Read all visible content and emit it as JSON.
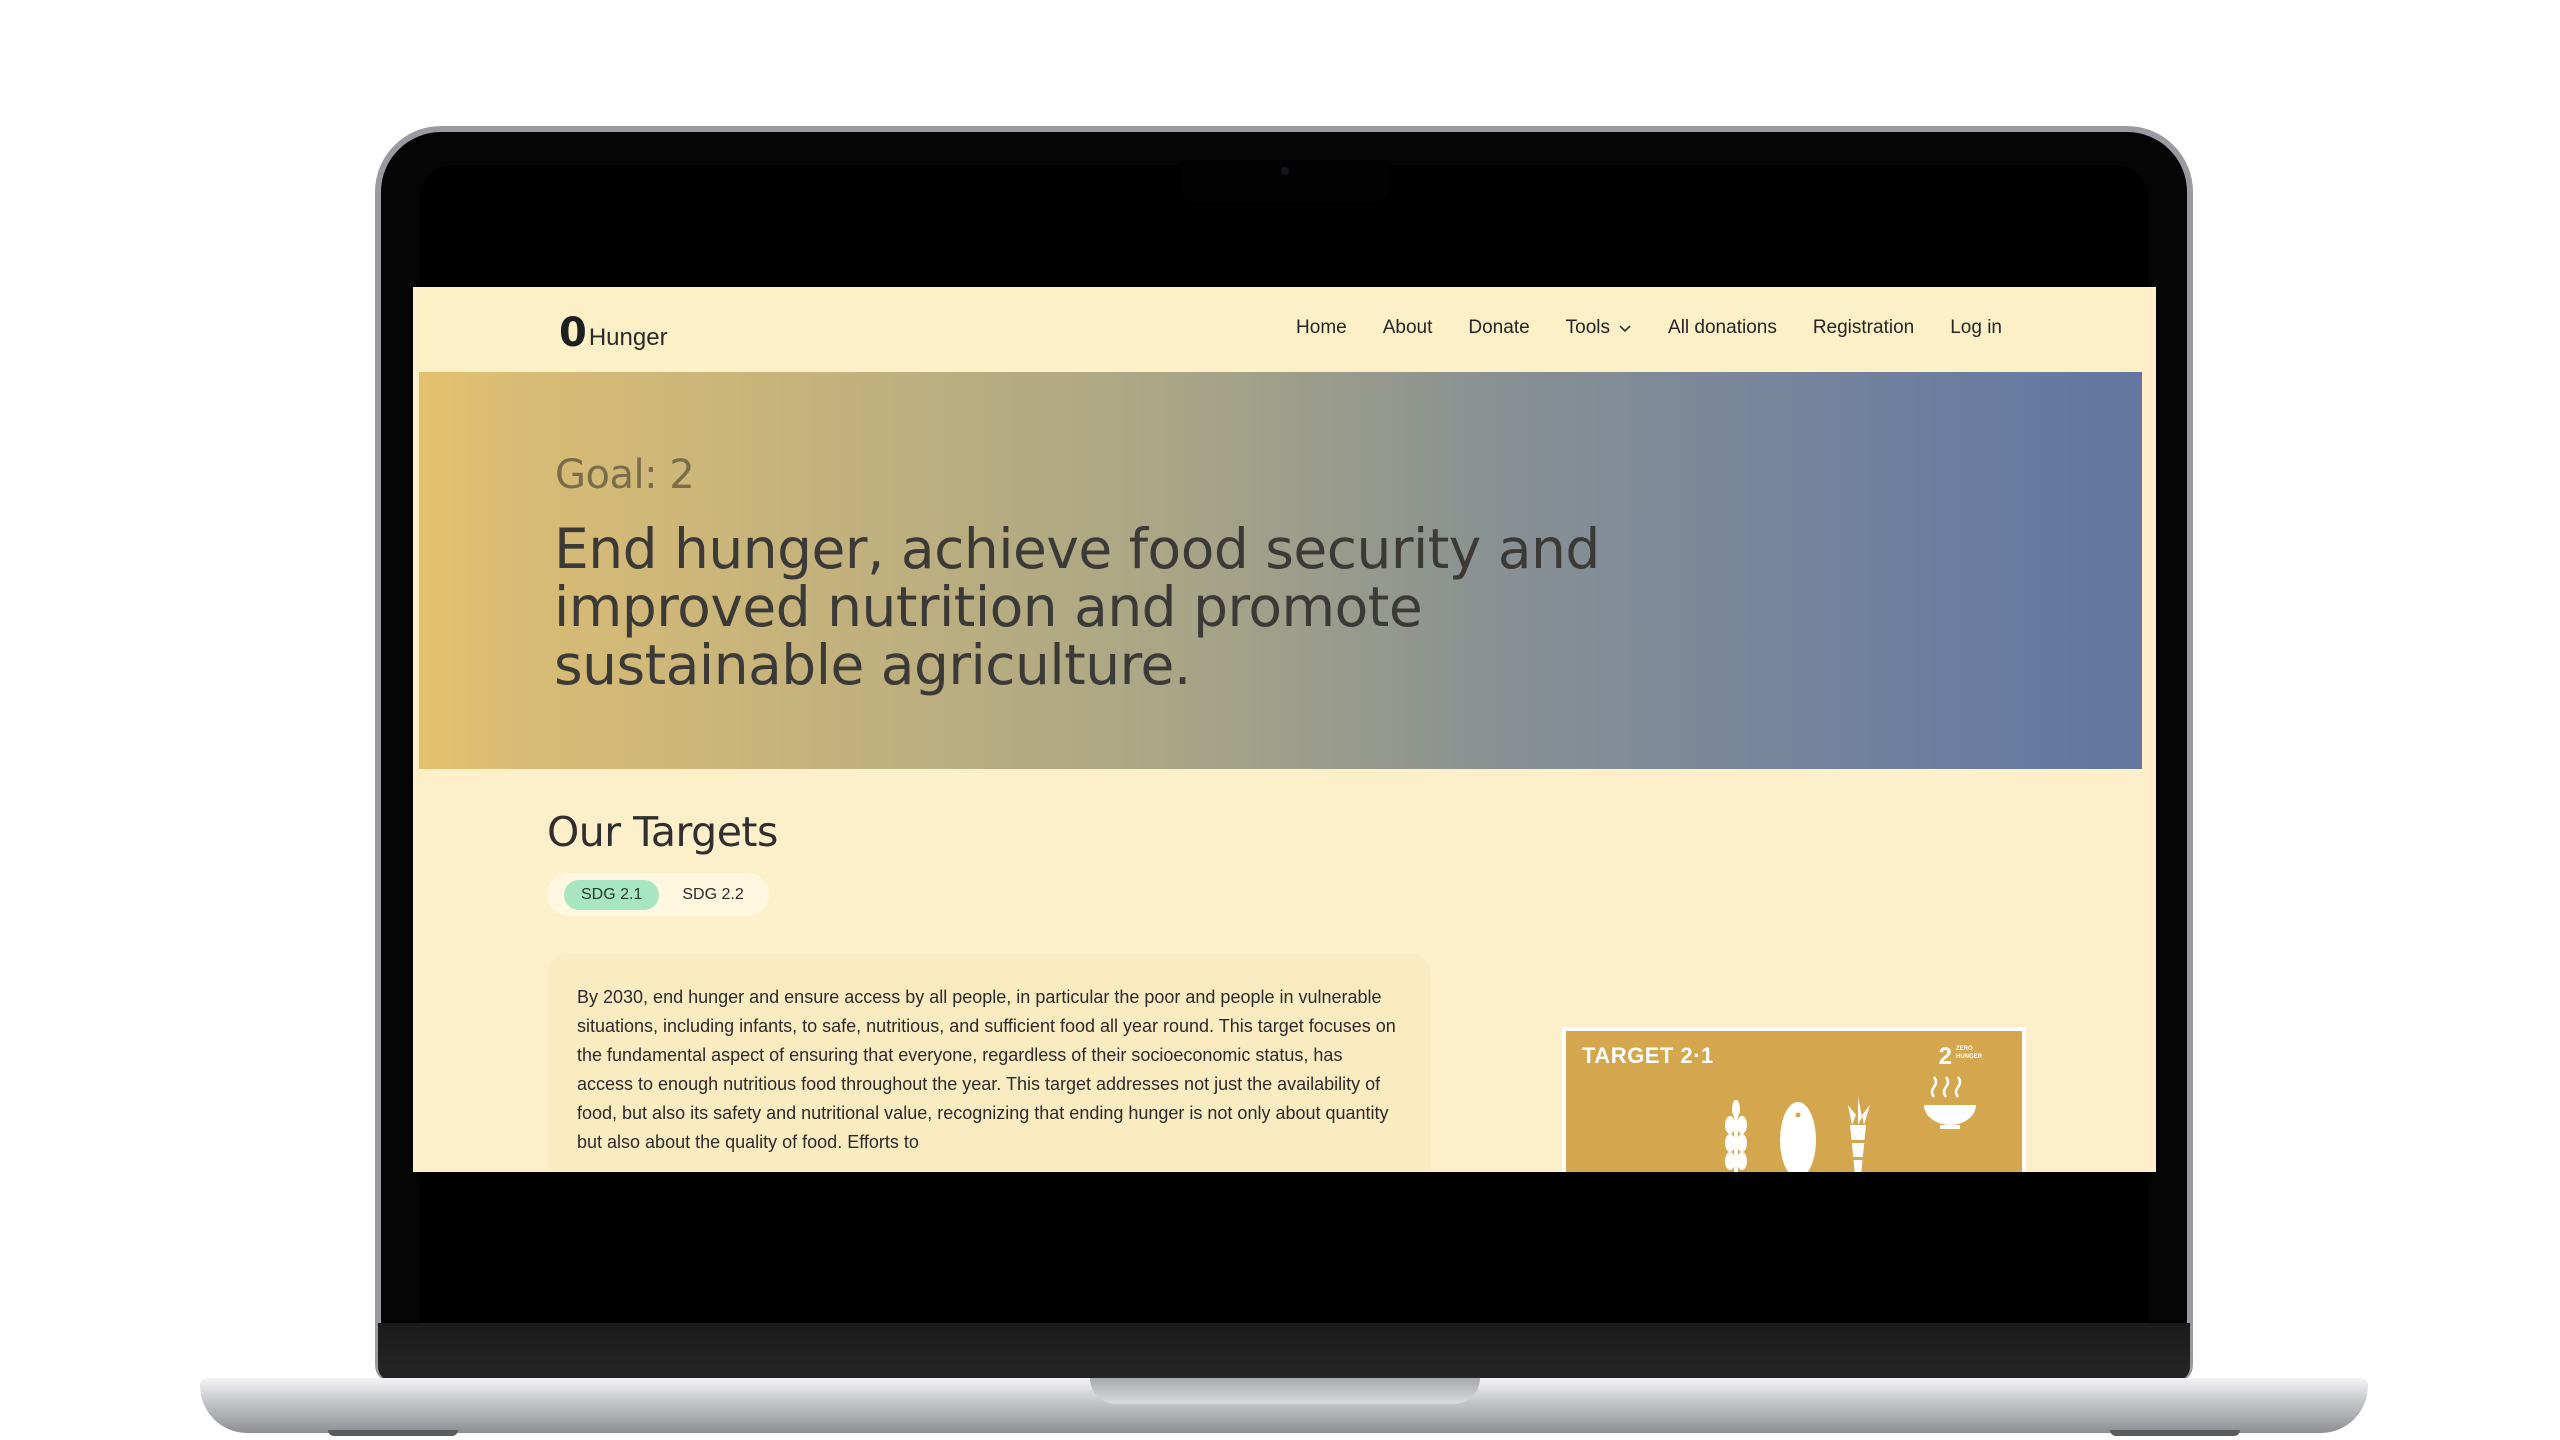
{
  "site": {
    "logo_mark": "0",
    "logo_text": "Hunger"
  },
  "nav": {
    "items": [
      {
        "label": "Home"
      },
      {
        "label": "About"
      },
      {
        "label": "Donate"
      },
      {
        "label": "Tools",
        "has_dropdown": true
      },
      {
        "label": "All donations"
      },
      {
        "label": "Registration"
      },
      {
        "label": "Log in"
      }
    ]
  },
  "hero": {
    "goal_label": "Goal: 2",
    "goal_title": "End hunger, achieve food security and improved nutrition and promote sustainable agriculture."
  },
  "targets": {
    "heading": "Our Targets",
    "tabs": [
      {
        "label": "SDG 2.1",
        "active": true
      },
      {
        "label": "SDG 2.2",
        "active": false
      }
    ],
    "active_text": "By 2030, end hunger and ensure access by all people, in particular the poor and people in vulnerable situations, including infants, to safe, nutritious, and sufficient food all year round. This target focuses on the fundamental aspect of ensuring that everyone, regardless of their socioeconomic status, has access to enough nutritious food throughout the year. This target addresses not just the availability of food, but also its safety and nutritional value, recognizing that ending hunger is not only about quantity but also about the quality of food. Efforts to",
    "image": {
      "label": "TARGET 2·1",
      "goal_number": "2",
      "goal_caption": "ZERO HUNGER",
      "icons": [
        "wheat-icon",
        "fish-icon",
        "carrot-icon",
        "bowl-icon"
      ]
    }
  },
  "colors": {
    "page_background": "#fdefc9",
    "header_background": "#fdf0c7",
    "hero_gradient_start": "#e6c16d",
    "hero_gradient_end": "#62769f",
    "active_tab": "#a8e6c2",
    "target_image": "#d4a64d"
  }
}
